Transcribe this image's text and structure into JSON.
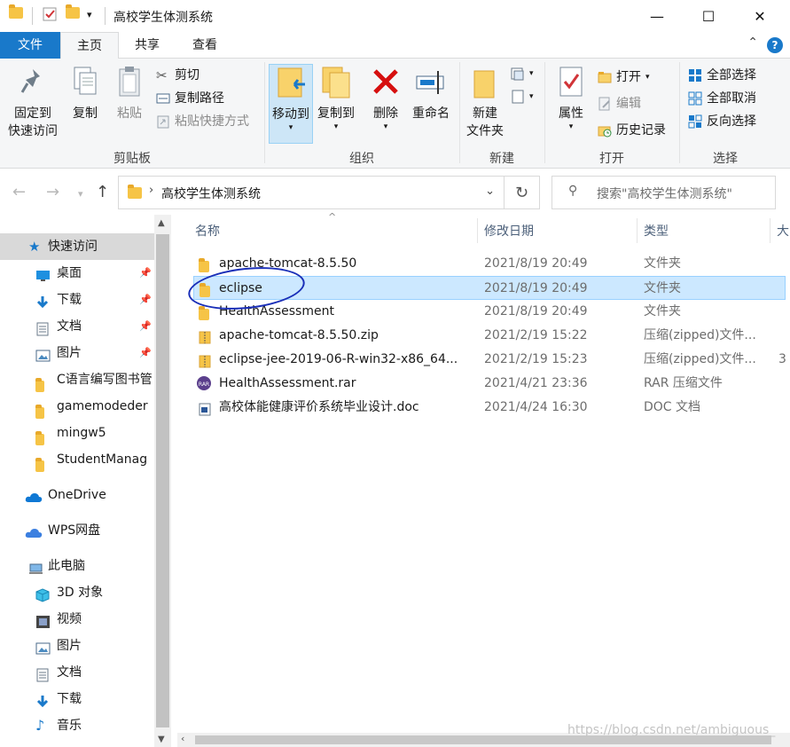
{
  "window": {
    "title": "高校学生体测系统",
    "minimize": "—",
    "maximize": "☐",
    "close": "✕",
    "qat_caret": "▾"
  },
  "tabs": [
    {
      "label": "文件"
    },
    {
      "label": "主页"
    },
    {
      "label": "共享"
    },
    {
      "label": "查看"
    }
  ],
  "ribbon": {
    "clipboard": {
      "label": "剪贴板",
      "pin_line1": "固定到",
      "pin_line2": "快速访问",
      "copy": "复制",
      "paste": "粘贴",
      "cut": "剪切",
      "copy_path": "复制路径",
      "paste_shortcut": "粘贴快捷方式"
    },
    "organize": {
      "label": "组织",
      "move_to": "移动到",
      "copy_to": "复制到",
      "delete": "删除",
      "rename": "重命名"
    },
    "new": {
      "label": "新建",
      "new_folder_line1": "新建",
      "new_folder_line2": "文件夹"
    },
    "open": {
      "label": "打开",
      "properties": "属性",
      "open": "打开",
      "edit": "编辑",
      "history": "历史记录"
    },
    "select": {
      "label": "选择",
      "select_all": "全部选择",
      "select_none": "全部取消",
      "invert": "反向选择"
    }
  },
  "address": {
    "path": "高校学生体测系统",
    "search_placeholder": "搜索\"高校学生体测系统\""
  },
  "nav": {
    "quick_access": "快速访问",
    "items": [
      {
        "label": "桌面",
        "pinned": true
      },
      {
        "label": "下载",
        "pinned": true
      },
      {
        "label": "文档",
        "pinned": true
      },
      {
        "label": "图片",
        "pinned": true
      },
      {
        "label": "C语言编写图书管"
      },
      {
        "label": "gamemodeder"
      },
      {
        "label": "mingw5"
      },
      {
        "label": "StudentManag"
      }
    ],
    "onedrive": "OneDrive",
    "wps": "WPS网盘",
    "this_pc": "此电脑",
    "pc_items": [
      {
        "label": "3D 对象"
      },
      {
        "label": "视频"
      },
      {
        "label": "图片"
      },
      {
        "label": "文档"
      },
      {
        "label": "下载"
      },
      {
        "label": "音乐"
      }
    ]
  },
  "columns": {
    "name": "名称",
    "date": "修改日期",
    "type": "类型",
    "size": "大"
  },
  "files": [
    {
      "name": "apache-tomcat-8.5.50",
      "date": "2021/8/19 20:49",
      "type": "文件夹",
      "size": "",
      "kind": "folder"
    },
    {
      "name": "eclipse",
      "date": "2021/8/19 20:49",
      "type": "文件夹",
      "size": "",
      "kind": "folder",
      "selected": true
    },
    {
      "name": "HealthAssessment",
      "date": "2021/8/19 20:49",
      "type": "文件夹",
      "size": "",
      "kind": "folder"
    },
    {
      "name": "apache-tomcat-8.5.50.zip",
      "date": "2021/2/19 15:22",
      "type": "压缩(zipped)文件...",
      "size": "",
      "kind": "zip"
    },
    {
      "name": "eclipse-jee-2019-06-R-win32-x86_64...",
      "date": "2021/2/19 15:23",
      "type": "压缩(zipped)文件...",
      "size": "3",
      "kind": "zip"
    },
    {
      "name": "HealthAssessment.rar",
      "date": "2021/4/21 23:36",
      "type": "RAR 压缩文件",
      "size": "",
      "kind": "rar"
    },
    {
      "name": "高校体能健康评价系统毕业设计.doc",
      "date": "2021/4/24 16:30",
      "type": "DOC 文档",
      "size": "",
      "kind": "doc"
    }
  ],
  "watermark": "https://blog.csdn.net/ambiguous_",
  "colors": {
    "accent": "#1979ca",
    "selection": "#cce8ff",
    "annotation": "#1a2fb8"
  }
}
